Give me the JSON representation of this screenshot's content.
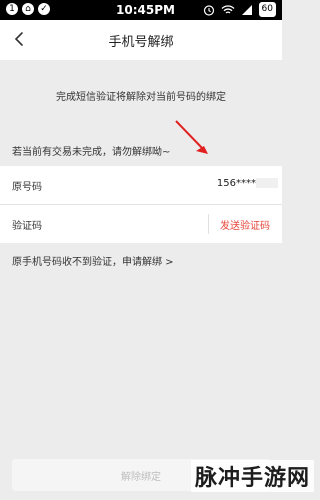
{
  "status_bar": {
    "left_icons": [
      "1",
      "⌂",
      "✓"
    ],
    "time": "10:45PM",
    "battery": "60"
  },
  "nav": {
    "title": "手机号解绑"
  },
  "notice": "完成短信验证将解除对当前号码的绑定",
  "warning": "若当前有交易未完成，请勿解绑呦~",
  "form": {
    "original_label": "原号码",
    "original_value": "156****",
    "code_label": "验证码",
    "send_code": "发送验证码"
  },
  "help_link": "原手机号码收不到验证，申请解绑 >",
  "unbind_button": "解除绑定",
  "watermark": "脉冲手游网",
  "colors": {
    "accent": "#e8443a",
    "arrow": "#e02020"
  }
}
